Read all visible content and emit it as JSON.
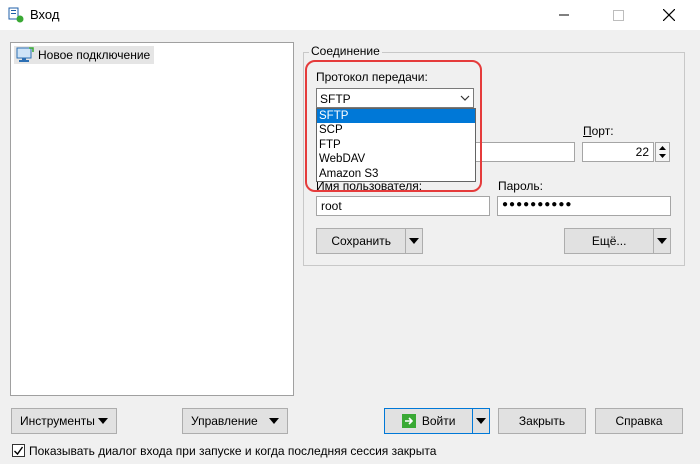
{
  "window": {
    "title": "Вход"
  },
  "sites": [
    {
      "label": "Новое подключение"
    }
  ],
  "session": {
    "group_title": "Соединение",
    "protocol_label": "Протокол передачи:",
    "protocol_selected": "SFTP",
    "protocol_options": [
      "SFTP",
      "SCP",
      "FTP",
      "WebDAV",
      "Amazon S3"
    ],
    "port_label": "Порт:",
    "port_value": "22",
    "username_label": "Имя пользователя:",
    "username_value": "root",
    "password_label": "Пароль:",
    "password_value": "●●●●●●●●●●",
    "save_label": "Сохранить",
    "advanced_label": "Ещё..."
  },
  "footer": {
    "tools_label": "Инструменты",
    "manage_label": "Управление",
    "login_label": "Войти",
    "close_label": "Закрыть",
    "help_label": "Справка",
    "show_dialog_label": "Показывать диалог входа при запуске и когда последняя сессия закрыта",
    "show_dialog_checked": true
  },
  "colors": {
    "selection": "#0078d7",
    "highlight_ring": "#e53b3b",
    "login_icon": "#3aa935"
  }
}
